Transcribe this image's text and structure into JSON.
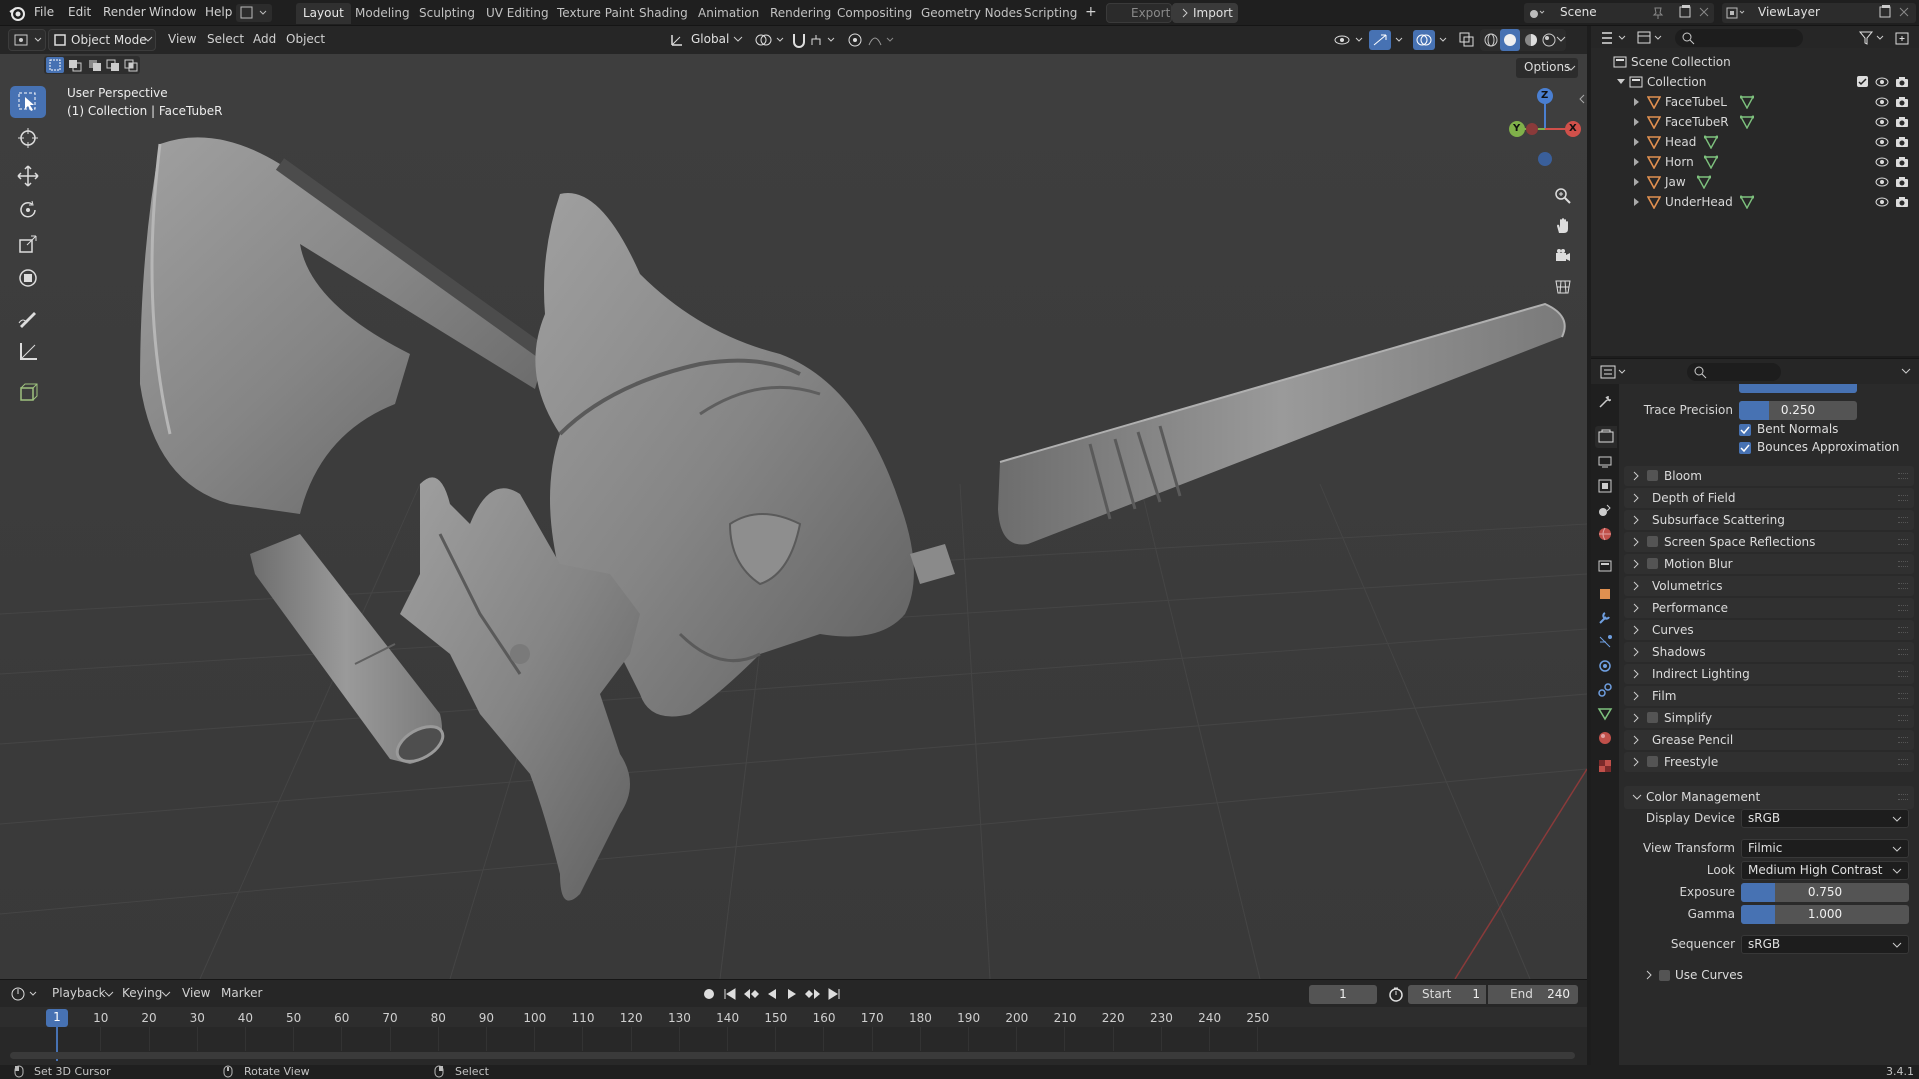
{
  "top_menu": [
    "File",
    "Edit",
    "Render",
    "Window",
    "Help"
  ],
  "workspaces": [
    {
      "label": "Layout",
      "active": true
    },
    {
      "label": "Modeling"
    },
    {
      "label": "Sculpting"
    },
    {
      "label": "UV Editing"
    },
    {
      "label": "Texture Paint"
    },
    {
      "label": "Shading"
    },
    {
      "label": "Animation"
    },
    {
      "label": "Rendering"
    },
    {
      "label": "Compositing"
    },
    {
      "label": "Geometry Nodes"
    },
    {
      "label": "Scripting"
    }
  ],
  "add_workspace": "+",
  "export_label": "Export",
  "import_label": "Import",
  "scene_name": "Scene",
  "view_layer": "ViewLayer",
  "viewport_header": {
    "mode": "Object Mode",
    "menus": [
      "View",
      "Select",
      "Add",
      "Object"
    ],
    "orientation": "Global",
    "options": "Options"
  },
  "viewport": {
    "perspective": "User Perspective",
    "collection_info": "(1) Collection | FaceTubeR",
    "gizmo": {
      "z": "Z",
      "y": "Y",
      "x": "X"
    }
  },
  "outliner": {
    "scene_collection": "Scene Collection",
    "collection": "Collection",
    "objects": [
      "FaceTubeL",
      "FaceTubeR",
      "Head",
      "Horn",
      "Jaw",
      "UnderHead"
    ]
  },
  "properties": {
    "trace_precision_label": "Trace Precision",
    "trace_precision_value": "0.250",
    "trace_precision_fraction": 0.25,
    "bent_normals": "Bent Normals",
    "bounces_approximation": "Bounces Approximation",
    "panels": [
      {
        "label": "Bloom",
        "checkbox": true
      },
      {
        "label": "Depth of Field",
        "checkbox": false
      },
      {
        "label": "Subsurface Scattering",
        "checkbox": false
      },
      {
        "label": "Screen Space Reflections",
        "checkbox": true
      },
      {
        "label": "Motion Blur",
        "checkbox": true
      },
      {
        "label": "Volumetrics",
        "checkbox": false
      },
      {
        "label": "Performance",
        "checkbox": false
      },
      {
        "label": "Curves",
        "checkbox": false
      },
      {
        "label": "Shadows",
        "checkbox": false
      },
      {
        "label": "Indirect Lighting",
        "checkbox": false
      },
      {
        "label": "Film",
        "checkbox": false
      },
      {
        "label": "Simplify",
        "checkbox": true
      },
      {
        "label": "Grease Pencil",
        "checkbox": false
      },
      {
        "label": "Freestyle",
        "checkbox": true
      }
    ],
    "color_management": {
      "title": "Color Management",
      "display_device_label": "Display Device",
      "display_device": "sRGB",
      "view_transform_label": "View Transform",
      "view_transform": "Filmic",
      "look_label": "Look",
      "look": "Medium High Contrast",
      "exposure_label": "Exposure",
      "exposure": "0.750",
      "exposure_fraction": 0.2,
      "gamma_label": "Gamma",
      "gamma": "1.000",
      "gamma_fraction": 0.2,
      "sequencer_label": "Sequencer",
      "sequencer": "sRGB",
      "use_curves": "Use Curves"
    }
  },
  "timeline": {
    "menus": [
      "Playback",
      "Keying",
      "View",
      "Marker"
    ],
    "current_frame": "1",
    "start_label": "Start",
    "start": "1",
    "end_label": "End",
    "end": "240",
    "ruler": [
      "1",
      "10",
      "20",
      "30",
      "40",
      "50",
      "60",
      "70",
      "80",
      "90",
      "100",
      "110",
      "120",
      "130",
      "140",
      "150",
      "160",
      "170",
      "180",
      "190",
      "200",
      "210",
      "220",
      "230",
      "240",
      "250"
    ]
  },
  "statusbar": {
    "left": "Set 3D Cursor",
    "mid": "Rotate View",
    "right": "Select",
    "version": "3.4.1"
  },
  "colors": {
    "accent": "#4772b3",
    "mesh_icon": "#e09050",
    "data_icon": "#7ec27e",
    "viewport_bg": "#3d3d3d"
  }
}
